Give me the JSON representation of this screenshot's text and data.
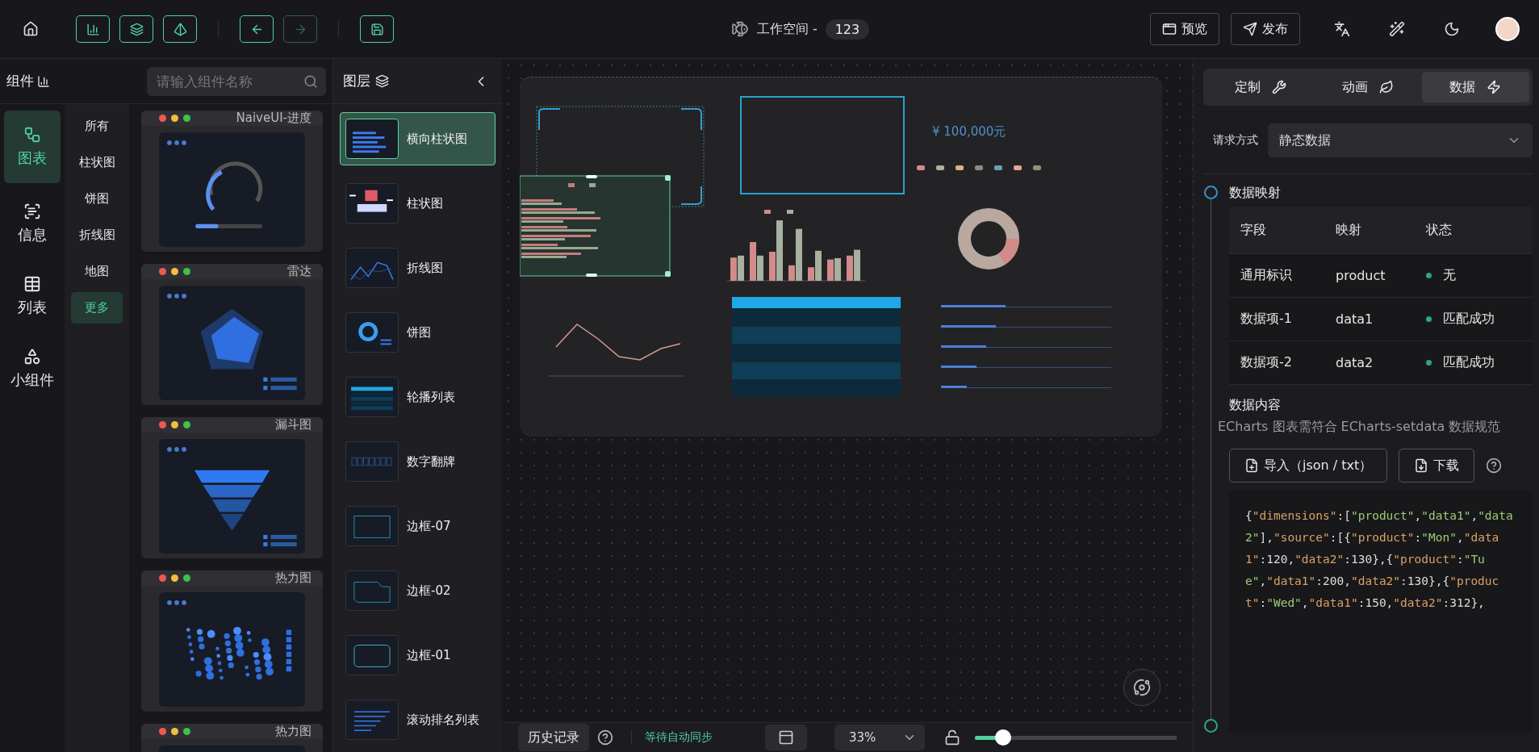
{
  "toolbar": {
    "tools": [
      {
        "kind": "chart"
      },
      {
        "kind": "layers"
      },
      {
        "kind": "pyramid"
      }
    ],
    "history": [
      {
        "kind": "undo",
        "disabled": false
      },
      {
        "kind": "redo",
        "disabled": true
      }
    ]
  },
  "workspace": {
    "label": "工作空间 -",
    "name": "123"
  },
  "actions": [
    {
      "kind": "preview",
      "label": "预览"
    },
    {
      "kind": "publish",
      "label": "发布"
    }
  ],
  "sidebar": {
    "title": "组件",
    "categories": [
      {
        "kind": "chart",
        "label": "图表",
        "selected": true
      },
      {
        "kind": "info",
        "label": "信息",
        "selected": false
      },
      {
        "kind": "table",
        "label": "列表",
        "selected": false
      },
      {
        "kind": "widget",
        "label": "小组件",
        "selected": false
      }
    ]
  },
  "search": {
    "placeholder": "请输入组件名称"
  },
  "subcategories": [
    {
      "label": "所有",
      "selected": false
    },
    {
      "label": "柱状图",
      "selected": false
    },
    {
      "label": "饼图",
      "selected": false
    },
    {
      "label": "折线图",
      "selected": false
    },
    {
      "label": "地图",
      "selected": false
    },
    {
      "label": "更多",
      "selected": true
    }
  ],
  "components": [
    {
      "kind": "progress",
      "title": "NaiveUI-进度"
    },
    {
      "kind": "radar",
      "title": "雷达"
    },
    {
      "kind": "funnel",
      "title": "漏斗图"
    },
    {
      "kind": "heatmap",
      "title": "热力图"
    },
    {
      "kind": "heatmap",
      "title": "热力图"
    }
  ],
  "layers": {
    "title": "图层",
    "items": [
      {
        "kind": "hbar",
        "label": "横向柱状图",
        "selected": true
      },
      {
        "kind": "bar",
        "label": "柱状图",
        "selected": false
      },
      {
        "kind": "line",
        "label": "折线图",
        "selected": false
      },
      {
        "kind": "pie",
        "label": "饼图",
        "selected": false
      },
      {
        "kind": "table",
        "label": "轮播列表",
        "selected": false
      },
      {
        "kind": "flip",
        "label": "数字翻牌",
        "selected": false
      },
      {
        "kind": "border7",
        "label": "边框-07",
        "selected": false
      },
      {
        "kind": "border2",
        "label": "边框-02",
        "selected": false
      },
      {
        "kind": "border1",
        "label": "边框-01",
        "selected": false
      },
      {
        "kind": "rank",
        "label": "滚动排名列表",
        "selected": false
      }
    ]
  },
  "canvas": {
    "amount": "¥ 100,000元"
  },
  "status_bar": {
    "history": "历史记录",
    "sync": "等待自动同步",
    "zoom": "33%",
    "locked": false,
    "level": 0.14
  },
  "panel": {
    "tabs": [
      {
        "kind": "custom",
        "label": "定制",
        "selected": false
      },
      {
        "kind": "animation",
        "label": "动画",
        "selected": false
      },
      {
        "kind": "data",
        "label": "数据",
        "selected": true
      }
    ],
    "request_label": "请求方式",
    "request_value": "静态数据",
    "mapping": {
      "title": "数据映射",
      "columns": [
        "字段",
        "映射",
        "状态"
      ],
      "rows": [
        [
          "通用标识",
          "product",
          "无"
        ],
        [
          "数据项-1",
          "data1",
          "匹配成功"
        ],
        [
          "数据项-2",
          "data2",
          "匹配成功"
        ]
      ]
    },
    "content": {
      "title": "数据内容",
      "hint": "ECharts 图表需符合 ECharts-setdata 数据规范",
      "buttons": [
        {
          "kind": "import",
          "label": "导入（json / txt）"
        },
        {
          "kind": "download",
          "label": "下载"
        }
      ],
      "code": "{\"dimensions\":[\"product\",\"data1\",\"data2\"],\"source\":[{\"product\":\"Mon\",\"data1\":120,\"data2\":130},{\"product\":\"Tue\",\"data1\":200,\"data2\":130},{\"product\":\"Wed\",\"data1\":150,\"data2\":312},"
    }
  }
}
